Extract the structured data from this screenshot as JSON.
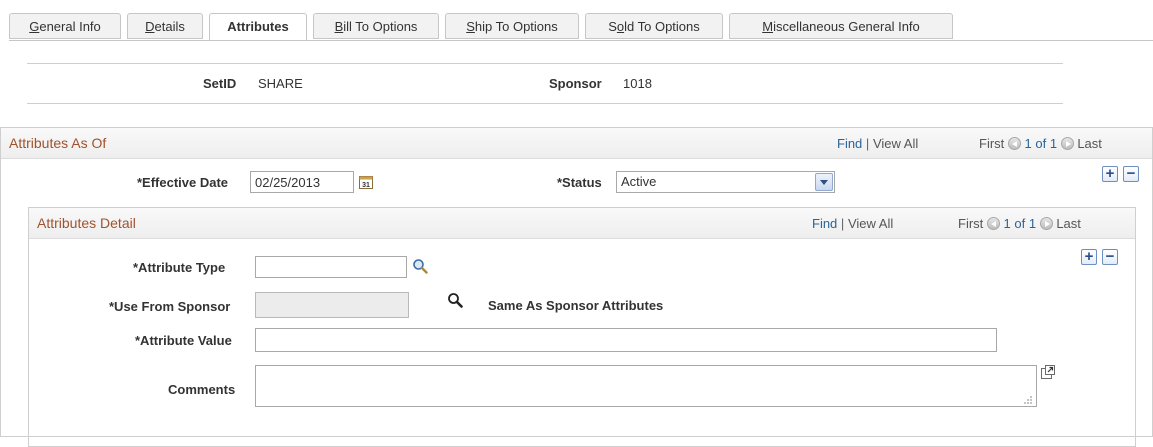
{
  "tabs": [
    {
      "pre": "",
      "ul": "G",
      "post": "eneral Info"
    },
    {
      "pre": "",
      "ul": "D",
      "post": "etails"
    },
    {
      "pre": "",
      "ul": "",
      "post": "Attributes"
    },
    {
      "pre": "",
      "ul": "B",
      "post": "ill To Options"
    },
    {
      "pre": "",
      "ul": "S",
      "post": "hip To Options"
    },
    {
      "pre": "S",
      "ul": "o",
      "post": "ld To Options"
    },
    {
      "pre": "",
      "ul": "M",
      "post": "iscellaneous General Info"
    }
  ],
  "keys": {
    "setid_label": "SetID",
    "setid_value": "SHARE",
    "sponsor_label": "Sponsor",
    "sponsor_value": "1018"
  },
  "outer": {
    "title": "Attributes As Of",
    "find": "Find",
    "sep": "|",
    "view_all": "View All",
    "first": "First",
    "count": "1 of 1",
    "last": "Last",
    "effdt_label": "*Effective Date",
    "effdt_value": "02/25/2013",
    "status_label": "*Status",
    "status_value": "Active",
    "add": "+",
    "remove": "−"
  },
  "inner": {
    "title": "Attributes Detail",
    "find": "Find",
    "sep": "|",
    "view_all": "View All",
    "first": "First",
    "count": "1 of 1",
    "last": "Last",
    "add": "+",
    "remove": "−",
    "attr_type_label": "*Attribute Type",
    "attr_type_value": "",
    "use_from_label": "*Use From Sponsor",
    "use_from_value": "",
    "same_as_text": "Same As Sponsor Attributes",
    "attr_value_label": "*Attribute Value",
    "attr_value_value": "",
    "comments_label": "Comments",
    "comments_value": ""
  }
}
